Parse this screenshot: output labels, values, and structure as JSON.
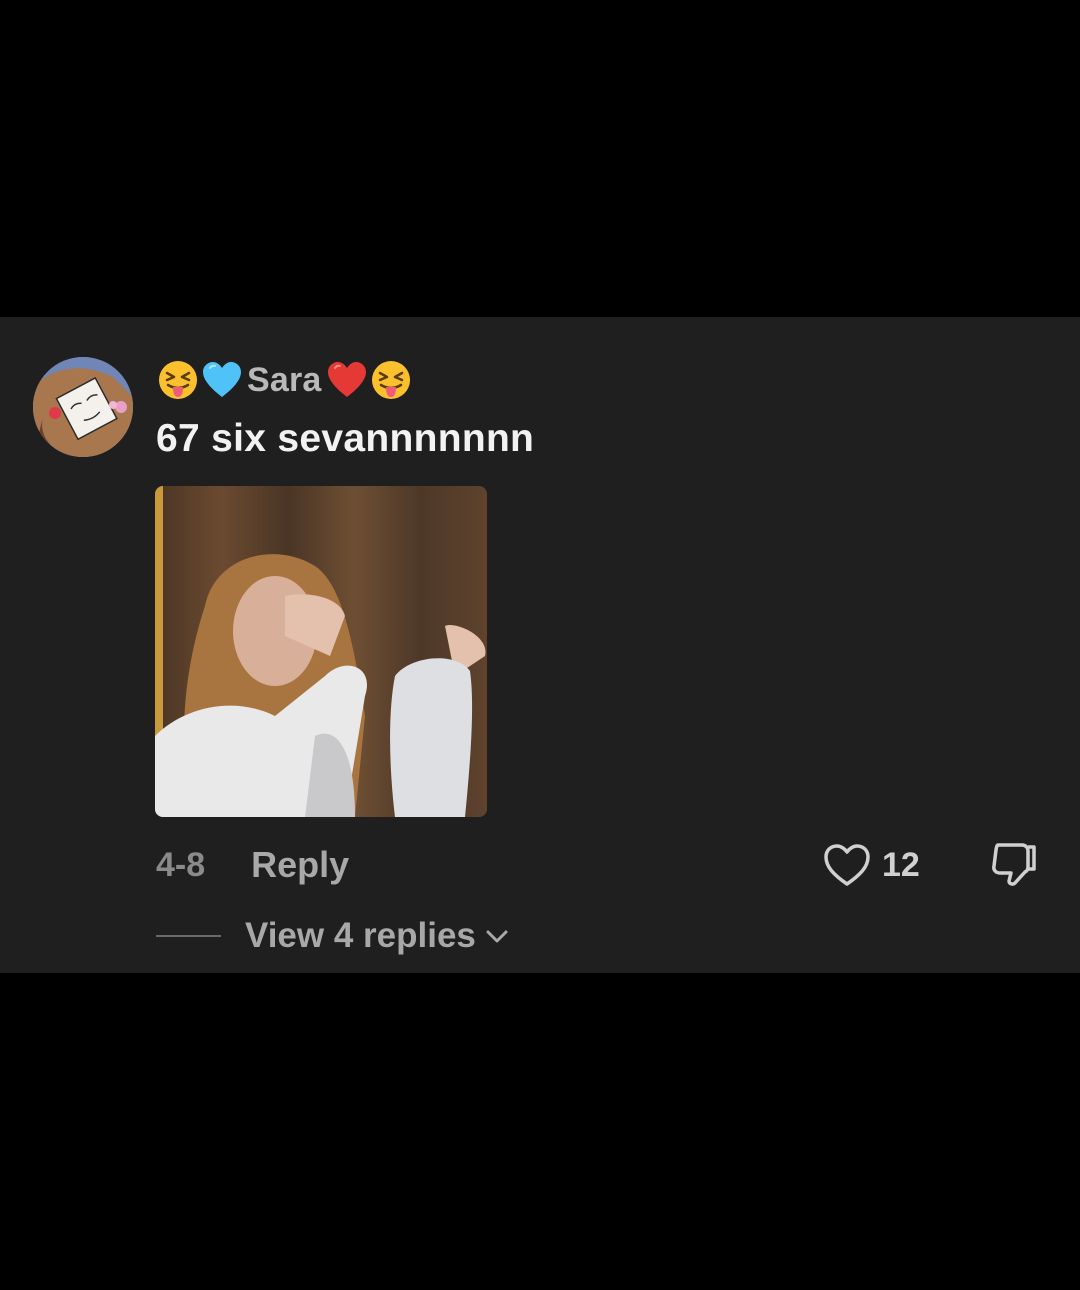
{
  "comment": {
    "username": "Sara",
    "username_emojis_left": [
      "squinting-tongue-emoji",
      "light-blue-heart-emoji"
    ],
    "username_emojis_right": [
      "red-heart-emoji",
      "squinting-tongue-emoji"
    ],
    "text": "67 six sevannnnnnn",
    "date": "4-8",
    "reply_label": "Reply",
    "like_count": "12",
    "view_replies_label": "View 4 replies"
  },
  "colors": {
    "background": "#000000",
    "card": "#1f1f1f",
    "primary_text": "#f2f2f2",
    "secondary_text": "#a8a8a8",
    "username_text": "#b9b9b9"
  },
  "icons": {
    "like": "heart-outline-icon",
    "dislike": "thumbs-down-icon",
    "expand": "chevron-down-icon"
  }
}
